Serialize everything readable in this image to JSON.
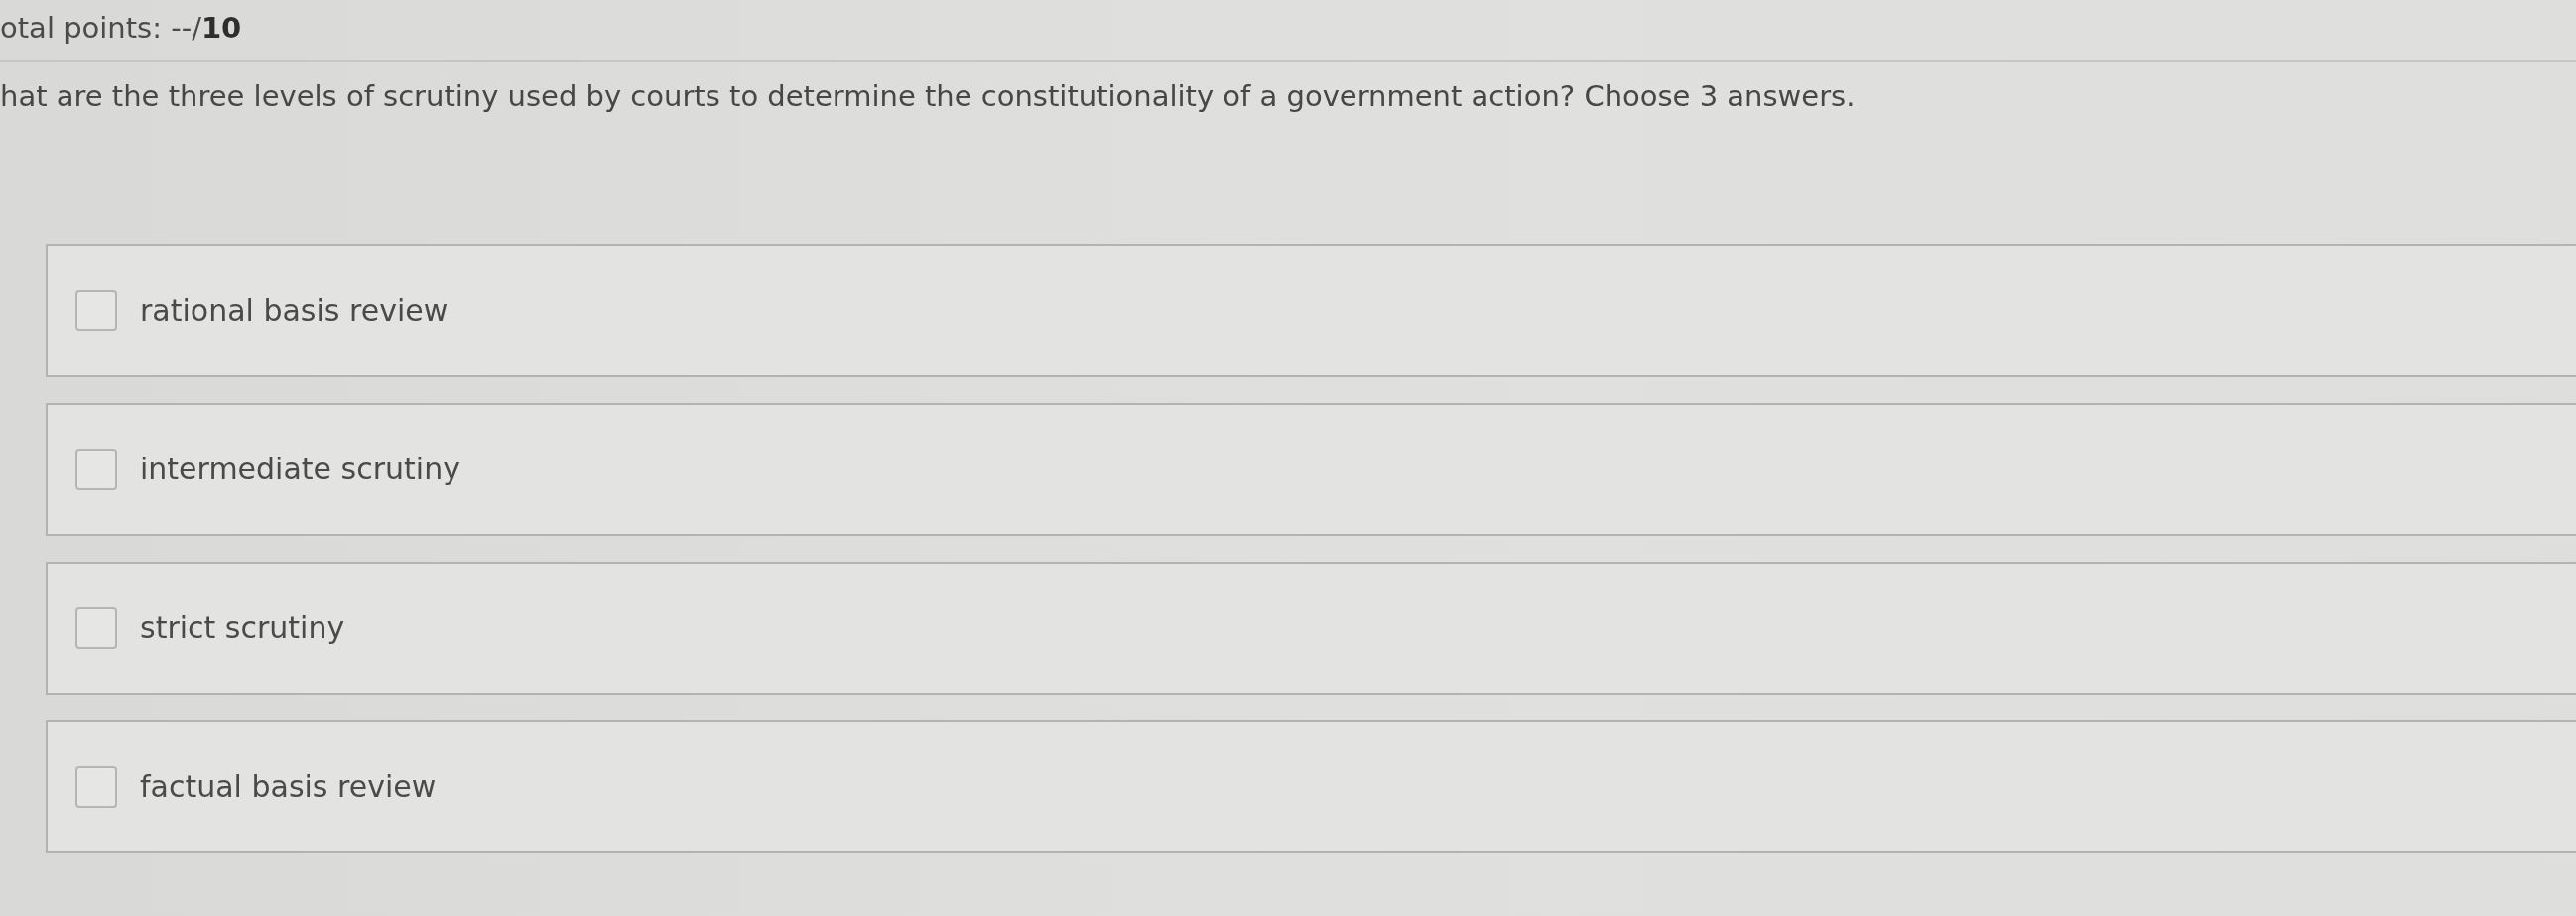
{
  "header": {
    "points": "otal points: --/**10**"
  },
  "question": {
    "text": "hat are the three levels of scrutiny used by courts to determine the constitutionality of a government action? Choose 3 answers."
  },
  "options": [
    {
      "label": "rational basis review",
      "checked": false
    },
    {
      "label": "intermediate scrutiny",
      "checked": false
    },
    {
      "label": "strict scrutiny",
      "checked": false
    },
    {
      "label": "factual basis review",
      "checked": false
    }
  ]
}
